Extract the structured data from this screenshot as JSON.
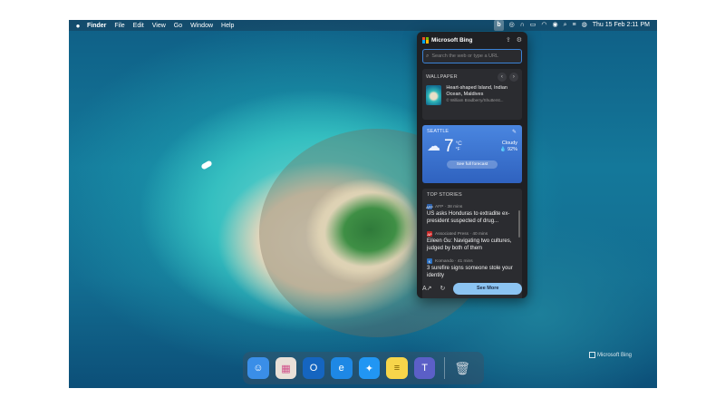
{
  "menubar": {
    "items": [
      "Finder",
      "File",
      "Edit",
      "View",
      "Go",
      "Window",
      "Help"
    ],
    "datetime": "Thu 15 Feb 2:11 PM",
    "bing_label": "b"
  },
  "panel": {
    "title": "Microsoft Bing",
    "search": {
      "placeholder": "Search the web or type a URL"
    },
    "wallpaper": {
      "section_label": "WALLPAPER",
      "title": "Heart-shaped Island, Indian Ocean, Maldives",
      "credit": "© William Bradberry/Shutterst..."
    },
    "weather": {
      "city": "SEATTLE",
      "temp": "7",
      "unit_c": "°C",
      "unit_f": "°F",
      "condition": "Cloudy",
      "humidity": "💧 92%",
      "forecast_label": "See full forecast"
    },
    "stories": {
      "section_label": "TOP STORIES",
      "items": [
        {
          "source": "AFP · 38 mins",
          "source_icon": "AFP",
          "icon_color": "#2b5fa8",
          "title": "US asks Honduras to extradite ex-president suspected of drug..."
        },
        {
          "source": "Associated Press · 40 mins",
          "source_icon": "AP",
          "icon_color": "#c62828",
          "title": "Eileen Gu: Navigating two cultures, judged by both of them"
        },
        {
          "source": "Komando · 41 mins",
          "source_icon": "K",
          "icon_color": "#2b6fbf",
          "title": "3 surefire signs someone stole your identity"
        }
      ]
    },
    "footer": {
      "see_more": "See More"
    }
  },
  "watermark": "Microsoft Bing",
  "dock": {
    "apps": [
      {
        "name": "Finder",
        "color": "#3a8ee8",
        "glyph": "☺"
      },
      {
        "name": "Launchpad",
        "color": "#e9e0d8",
        "glyph": "▦"
      },
      {
        "name": "Outlook",
        "color": "#1565c0",
        "glyph": "O"
      },
      {
        "name": "Edge",
        "color": "#1e88e5",
        "glyph": "e"
      },
      {
        "name": "Safari",
        "color": "#2196f3",
        "glyph": "✦"
      },
      {
        "name": "Notes",
        "color": "#f7d54a",
        "glyph": "≡"
      },
      {
        "name": "Teams",
        "color": "#5b5fc7",
        "glyph": "T"
      }
    ],
    "trash_glyph": "🗑"
  }
}
